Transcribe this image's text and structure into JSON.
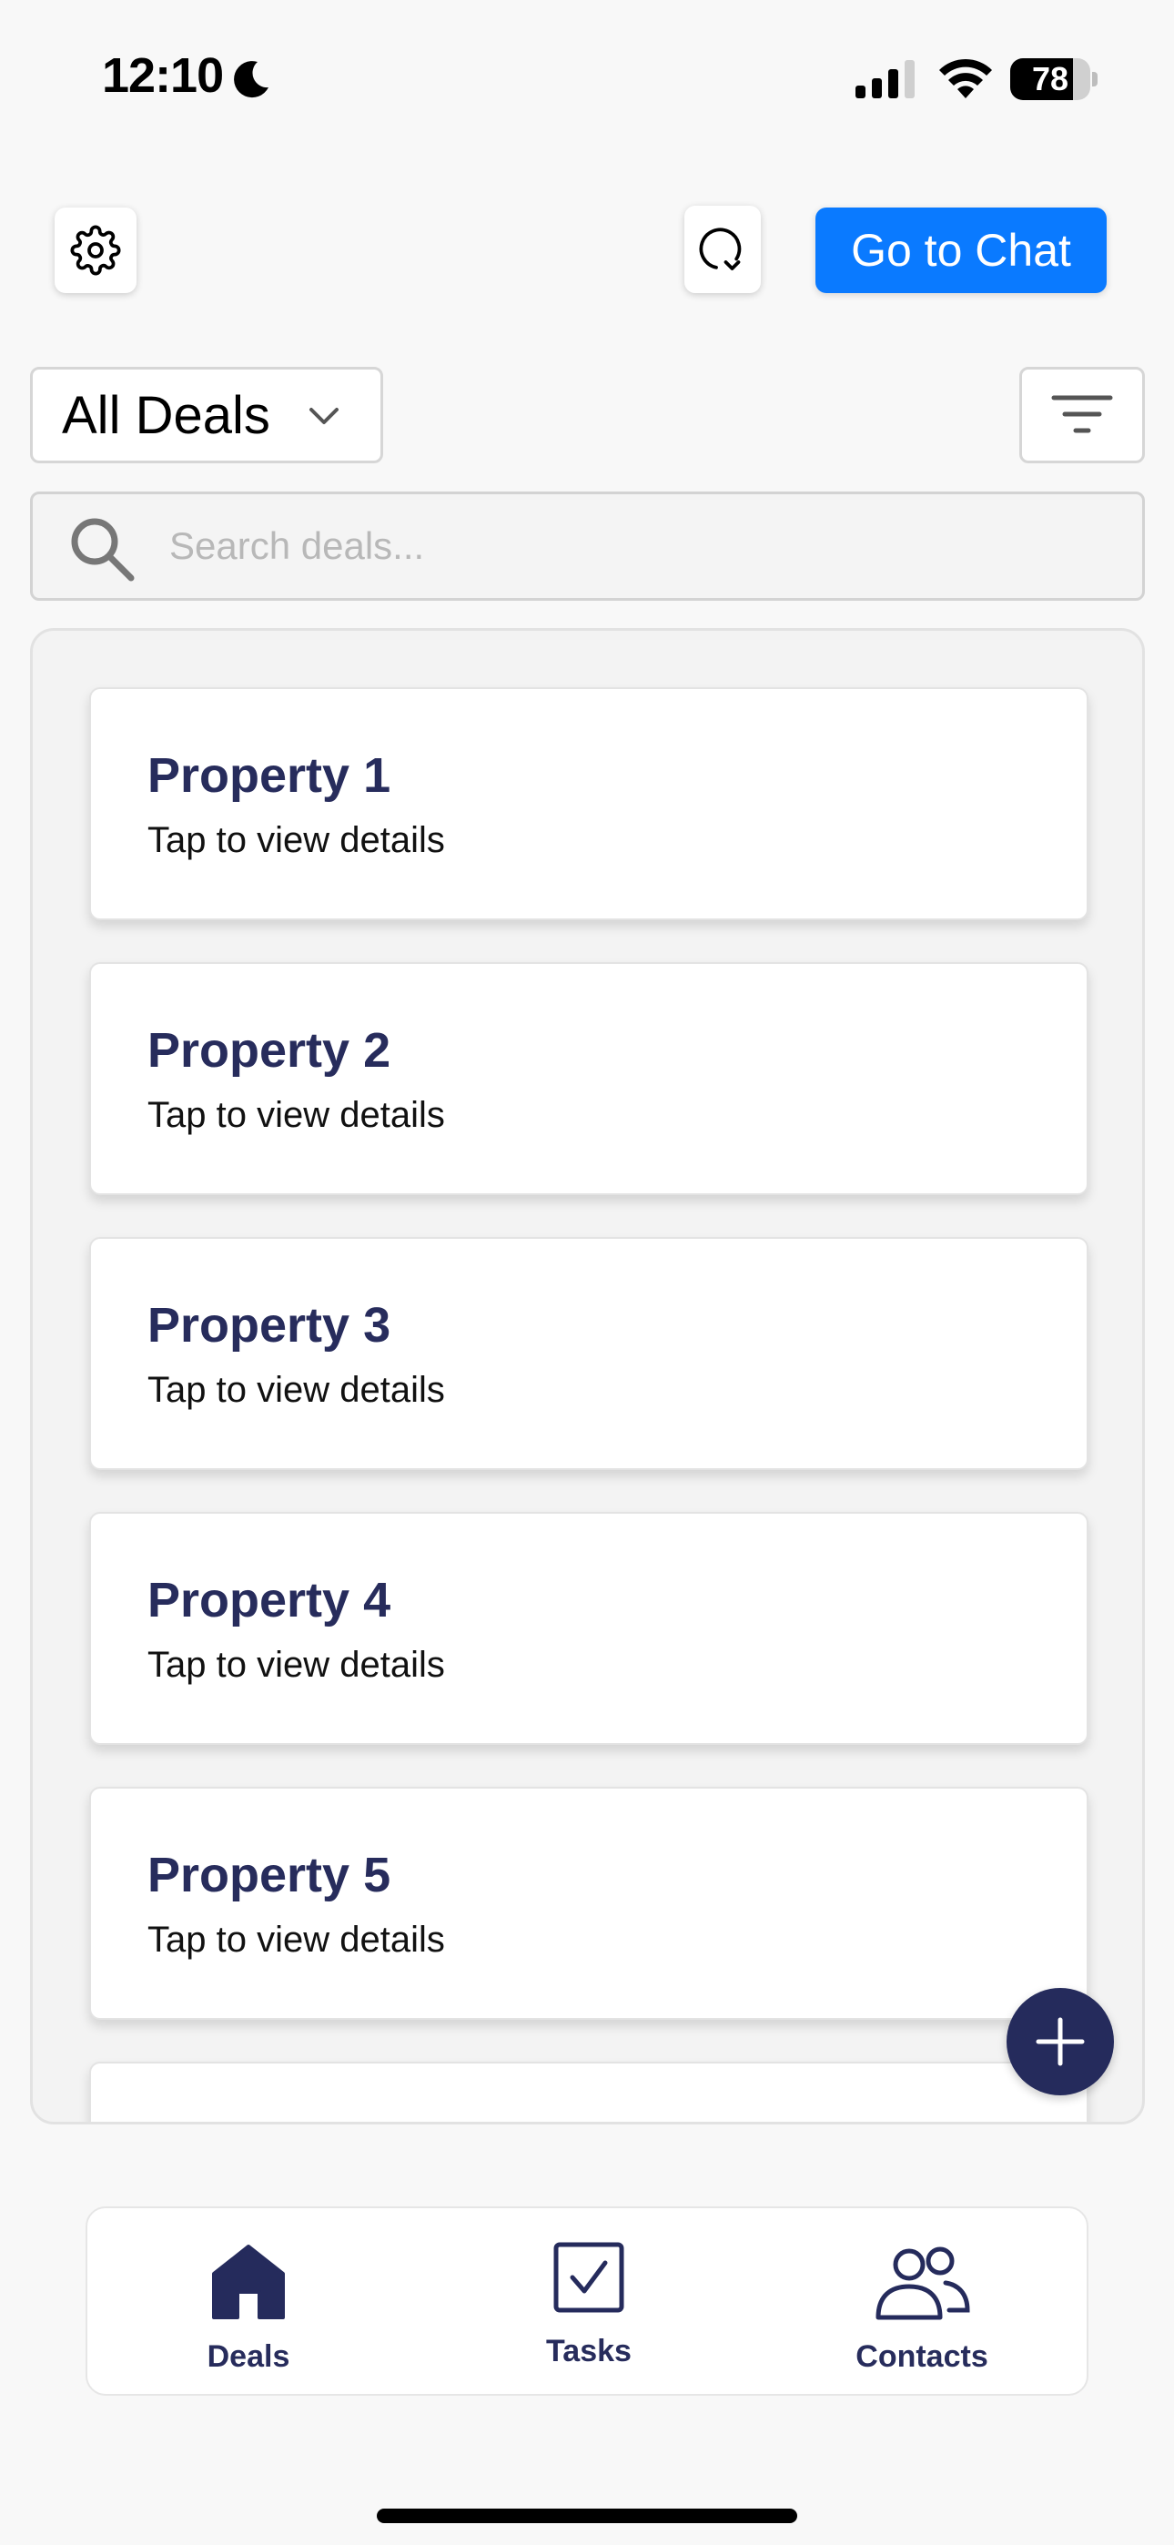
{
  "status_bar": {
    "time": "12:10",
    "battery_level": "78",
    "battery_fraction": 0.78
  },
  "header": {
    "settings_icon": "gear-icon",
    "refresh_icon": "refresh-icon",
    "chat_button_label": "Go to Chat",
    "chat_button_color": "#0a7aff"
  },
  "filters": {
    "deals_dropdown_value": "All Deals",
    "filter_icon": "filter-lines-icon"
  },
  "search": {
    "placeholder": "Search deals...",
    "value": ""
  },
  "deals": [
    {
      "title": "Property 1",
      "subtitle": "Tap to view details"
    },
    {
      "title": "Property 2",
      "subtitle": "Tap to view details"
    },
    {
      "title": "Property 3",
      "subtitle": "Tap to view details"
    },
    {
      "title": "Property 4",
      "subtitle": "Tap to view details"
    },
    {
      "title": "Property 5",
      "subtitle": "Tap to view details"
    },
    {
      "title": "",
      "subtitle": ""
    }
  ],
  "fab": {
    "icon": "plus-icon",
    "color": "#252b5c"
  },
  "bottom_nav": {
    "items": [
      {
        "label": "Deals",
        "icon": "home-icon",
        "active": true
      },
      {
        "label": "Tasks",
        "icon": "checkbox-icon",
        "active": false
      },
      {
        "label": "Contacts",
        "icon": "people-icon",
        "active": false
      }
    ]
  },
  "colors": {
    "accent_navy": "#272c5c",
    "primary_blue": "#0a7aff"
  }
}
